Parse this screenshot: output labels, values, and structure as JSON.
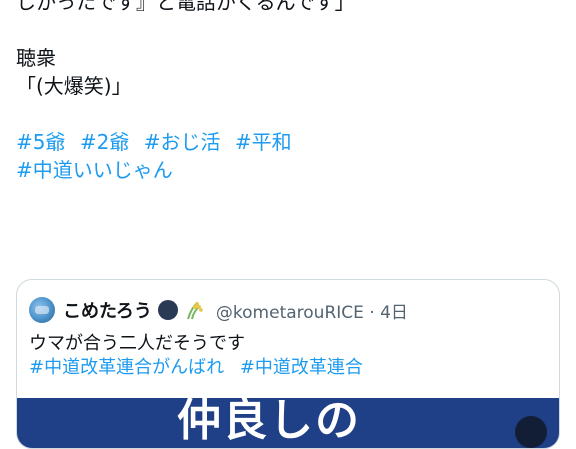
{
  "tweet": {
    "lines": {
      "cut_top": "しかったです』と電話がくるんです」",
      "speaker": "聴衆",
      "quote": "「(大爆笑)」"
    },
    "hashtags_row1": [
      "#5爺",
      "#2爺",
      "#おじ活",
      "#平和"
    ],
    "hashtags_row2": [
      "#中道いいじゃん"
    ]
  },
  "quote_tweet": {
    "author_name": "こめたろう",
    "handle_and_time": "@kometarouRICE · 4日",
    "text": "ウマが合う二人だそうです",
    "hashtags": [
      "#中道改革連合がんばれ",
      "#中道改革連合"
    ],
    "media_caption_partial": "仲良しの"
  },
  "colors": {
    "link": "#1d9bf0",
    "text": "#0f1419",
    "muted": "#536471",
    "border": "#cfd9de",
    "media_bg": "#1f3f86"
  },
  "icons": {
    "avatar": "avatar-image",
    "moon": "moon-emoji-icon",
    "rice": "rice-plant-emoji-icon"
  }
}
